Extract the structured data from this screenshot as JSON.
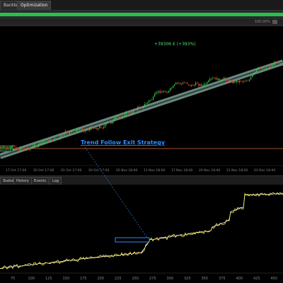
{
  "tabs": [
    {
      "label": "Backtesting",
      "active": false
    },
    {
      "label": "Optimization",
      "active": true
    }
  ],
  "progress": {
    "value": 1.0,
    "color": "#26c24a",
    "status": "100.00%"
  },
  "chart": {
    "annotation": "+39306 € (+393%)",
    "watermark": "Trend Follow Exit Strategy",
    "price_tag": "Δ",
    "x_labels": [
      "17 Oct 17:00",
      "20 Oct 17:00",
      "01 Oct 17:00",
      "20 Oct 17:00",
      "05 Nov 18:00",
      "11 Nov 18:00",
      "17 Nov 18:00",
      "20 Nov 18:00",
      "21 Nov 18:00",
      "03 Dec 18:00"
    ],
    "colors": {
      "up": "#2ecc40",
      "down": "#e03c31",
      "trend": "#8fb3a8"
    }
  },
  "bottom_tabs": [
    "Statistics",
    "History",
    "Events",
    "Log"
  ],
  "equity": {
    "x_labels": [
      "75",
      "100",
      "125",
      "150",
      "175",
      "200",
      "225",
      "250",
      "275",
      "300",
      "325",
      "350",
      "375",
      "400",
      "425",
      "450"
    ],
    "colors": {
      "balance": "#ffffff",
      "equity": "#f2e64a"
    }
  }
}
